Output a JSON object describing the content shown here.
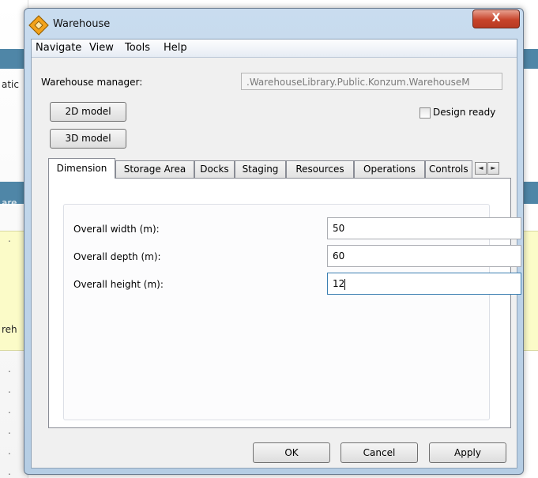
{
  "background": {
    "fragments": [
      "atic",
      "are",
      "reh"
    ],
    "dots": [
      ".",
      ".",
      ".",
      ".",
      ".",
      ".",
      "."
    ]
  },
  "window": {
    "title": "Warehouse",
    "close_label": "X"
  },
  "menu": {
    "items": [
      "Navigate",
      "View",
      "Tools",
      "Help"
    ]
  },
  "form": {
    "warehouse_manager_label": "Warehouse manager:",
    "warehouse_manager_value": ".WarehouseLibrary.Public.Konzum.WarehouseM",
    "btn_2d": "2D model",
    "btn_3d": "3D model",
    "design_ready_label": "Design ready",
    "design_ready_checked": false
  },
  "tabs": {
    "items": [
      "Dimension",
      "Storage Area",
      "Docks",
      "Staging",
      "Resources",
      "Operations",
      "Controls"
    ],
    "active": "Dimension",
    "scroll_left": "◄",
    "scroll_right": "►"
  },
  "dimension": {
    "width_label": "Overall width (m):",
    "width_value": "50",
    "depth_label": "Overall depth (m):",
    "depth_value": "60",
    "height_label": "Overall height (m):",
    "height_value": "12"
  },
  "buttons": {
    "ok": "OK",
    "cancel": "Cancel",
    "apply": "Apply"
  }
}
